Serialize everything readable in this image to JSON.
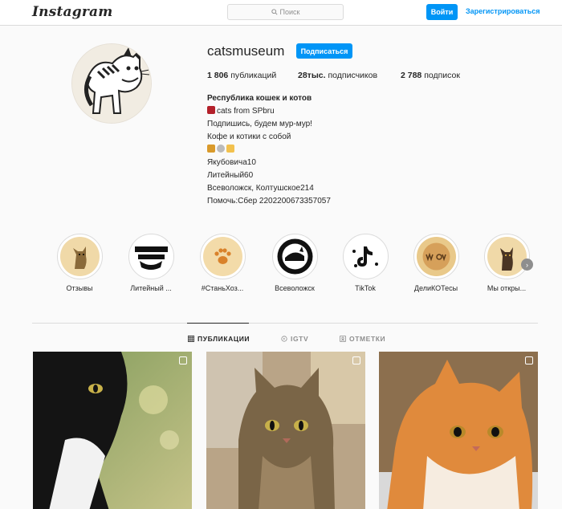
{
  "header": {
    "logo": "Instagram",
    "search_placeholder": "Поиск",
    "login_label": "Войти",
    "register_label": "Зарегистрироваться"
  },
  "profile": {
    "username": "catsmuseum",
    "follow_label": "Подписаться",
    "posts_count": "1 806",
    "posts_label": "публикаций",
    "followers_count": "28тыс.",
    "followers_label": "подписчиков",
    "following_count": "2 788",
    "following_label": "подписок",
    "bio_name": "Республика кошек и котов",
    "bio_lines": [
      "cats from SPbru",
      "Подпишись, будем мур-мур!",
      "Кофе и котики с собой",
      "",
      "Якубовича10",
      "Литейный60",
      "Всеволожск, Колтушское214",
      "Помочь:Сбер 2202200673357057"
    ]
  },
  "highlights": [
    {
      "label": "Отзывы",
      "icon": "cat-drawing-icon"
    },
    {
      "label": "Литейный ...",
      "icon": "respublika-kotov-logo-icon"
    },
    {
      "label": "#СтаньХоз...",
      "icon": "paw-icon"
    },
    {
      "label": "Всеволожск",
      "icon": "cat-museum-logo-icon"
    },
    {
      "label": "TikTok",
      "icon": "tiktok-icon"
    },
    {
      "label": "ДелиКОТесы",
      "icon": "meow-cookie-icon"
    },
    {
      "label": "Мы откры...",
      "icon": "cat-drawing-icon"
    }
  ],
  "tabs": [
    {
      "label": "ПУБЛИКАЦИИ",
      "icon": "grid-icon",
      "active": true
    },
    {
      "label": "IGTV",
      "icon": "igtv-icon",
      "active": false
    },
    {
      "label": "ОТМЕТКИ",
      "icon": "tag-icon",
      "active": false
    }
  ],
  "colors": {
    "accent": "#0095f6",
    "text": "#262626",
    "muted": "#8e8e8e",
    "border": "#dbdbdb",
    "background": "#fafafa"
  }
}
